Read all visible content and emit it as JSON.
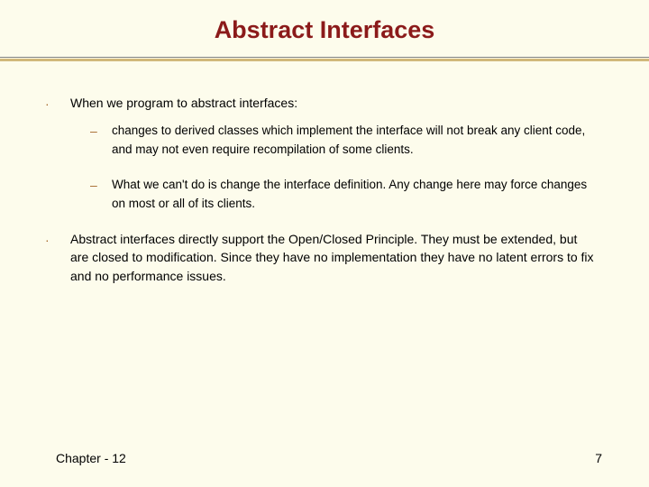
{
  "title": "Abstract Interfaces",
  "bullets": {
    "top": "When we program to abstract interfaces:",
    "bottom": "Abstract interfaces directly support the Open/Closed Principle.  They must be extended, but are closed to modification.  Since they have no implementation they have no latent errors to fix and no performance issues."
  },
  "subs": {
    "a": "changes to derived classes which implement the interface will not break any client code, and may not even require recompilation of some clients.",
    "b": "What we can't do is change the interface definition.  Any change here may force changes on most or all of its clients."
  },
  "footer": {
    "left": "Chapter - 12",
    "right": "7"
  },
  "marks": {
    "bullet": "·",
    "dash": "–"
  }
}
